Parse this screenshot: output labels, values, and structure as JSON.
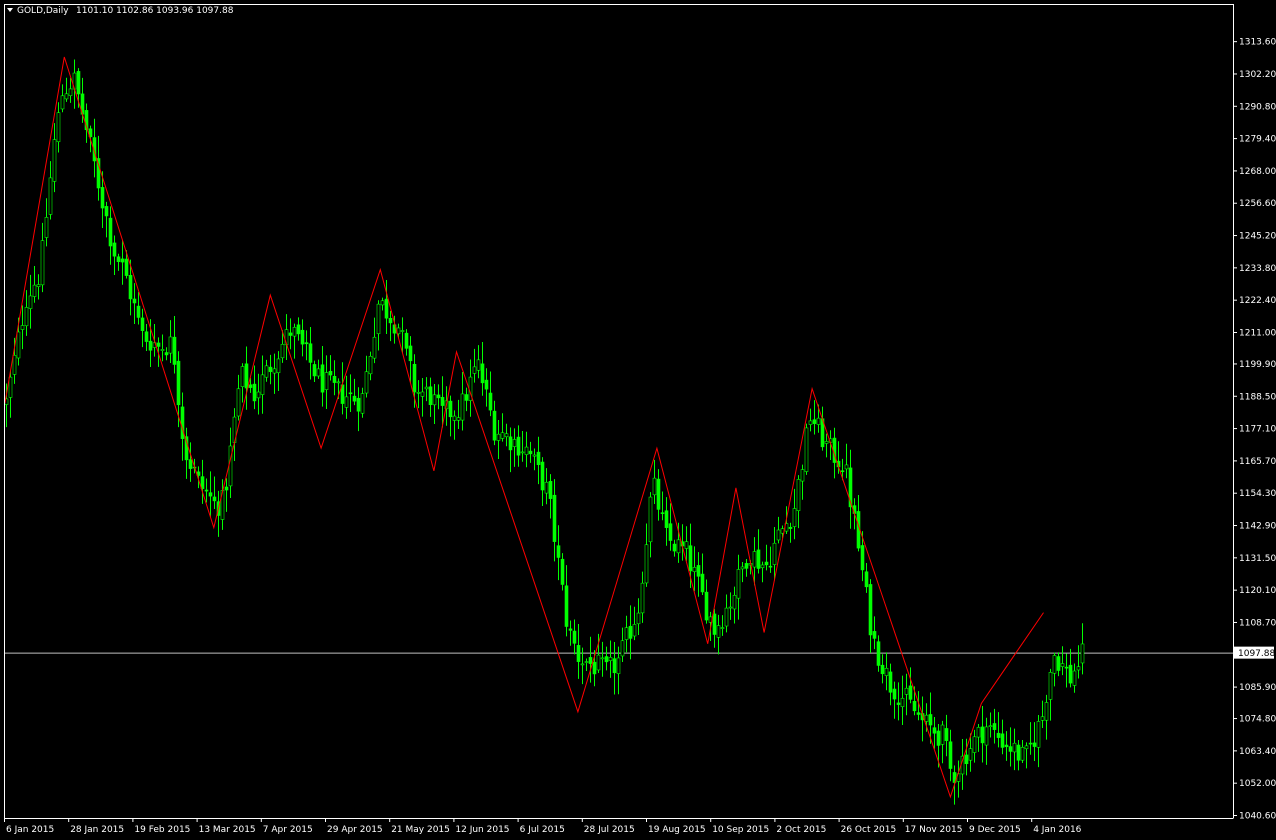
{
  "header": {
    "symbol": "GOLD,Daily",
    "ohlc": "1101.10 1102.86 1093.96 1097.88"
  },
  "colors": {
    "background": "#000000",
    "candle": "#00ff00",
    "zigzag": "#ff0000",
    "axis": "#ffffff",
    "price_line": "#c0c0c0"
  },
  "chart_data": {
    "type": "line",
    "title": "GOLD,Daily",
    "ylim": [
      1040.6,
      1319.3
    ],
    "y_ticks": [
      "1313.60",
      "1302.20",
      "1290.80",
      "1279.40",
      "1268.00",
      "1256.60",
      "1245.20",
      "1233.80",
      "1222.40",
      "1211.00",
      "1199.90",
      "1188.50",
      "1177.10",
      "1165.70",
      "1154.30",
      "1142.90",
      "1131.50",
      "1120.10",
      "1108.70",
      "1097.88",
      "1085.90",
      "1074.80",
      "1063.40",
      "1052.00",
      "1040.60"
    ],
    "x_ticks": [
      "6 Jan 2015",
      "28 Jan 2015",
      "19 Feb 2015",
      "13 Mar 2015",
      "7 Apr 2015",
      "29 Apr 2015",
      "21 May 2015",
      "12 Jun 2015",
      "6 Jul 2015",
      "28 Jul 2015",
      "19 Aug 2015",
      "10 Sep 2015",
      "2 Oct 2015",
      "26 Oct 2015",
      "17 Nov 2015",
      "9 Dec 2015",
      "4 Jan 2016"
    ],
    "current_price": 1097.88,
    "series": [
      {
        "type": "candlestick-close-path",
        "x": [
          "2015-01-02",
          "2015-01-06",
          "2015-01-09",
          "2015-01-14",
          "2015-01-19",
          "2015-01-22",
          "2015-01-26",
          "2015-01-30",
          "2015-02-04",
          "2015-02-09",
          "2015-02-13",
          "2015-02-19",
          "2015-02-25",
          "2015-03-02",
          "2015-03-06",
          "2015-03-11",
          "2015-03-17",
          "2015-03-20",
          "2015-03-26",
          "2015-03-31",
          "2015-04-07",
          "2015-04-13",
          "2015-04-17",
          "2015-04-23",
          "2015-04-29",
          "2015-05-04",
          "2015-05-08",
          "2015-05-14",
          "2015-05-21",
          "2015-05-27",
          "2015-06-01",
          "2015-06-05",
          "2015-06-12",
          "2015-06-18",
          "2015-06-24",
          "2015-06-30",
          "2015-07-06",
          "2015-07-13",
          "2015-07-20",
          "2015-07-24",
          "2015-07-28",
          "2015-08-03",
          "2015-08-07",
          "2015-08-14",
          "2015-08-19",
          "2015-08-24",
          "2015-08-31",
          "2015-09-04",
          "2015-09-10",
          "2015-09-16",
          "2015-09-22",
          "2015-09-28",
          "2015-10-02",
          "2015-10-08",
          "2015-10-14",
          "2015-10-20",
          "2015-10-26",
          "2015-10-30",
          "2015-11-05",
          "2015-11-11",
          "2015-11-17",
          "2015-11-23",
          "2015-11-30",
          "2015-12-03",
          "2015-12-09",
          "2015-12-15",
          "2015-12-21",
          "2015-12-29",
          "2016-01-04",
          "2016-01-08",
          "2016-01-14",
          "2016-01-19"
        ],
        "y": [
          1186,
          1207,
          1223,
          1232,
          1278,
          1296,
          1300,
          1284,
          1262,
          1240,
          1232,
          1210,
          1206,
          1207,
          1170,
          1158,
          1150,
          1151,
          1196,
          1189,
          1202,
          1212,
          1205,
          1194,
          1190,
          1188,
          1187,
          1222,
          1213,
          1190,
          1189,
          1182,
          1184,
          1200,
          1177,
          1173,
          1169,
          1154,
          1106,
          1096,
          1094,
          1091,
          1095,
          1114,
          1158,
          1138,
          1133,
          1122,
          1106,
          1117,
          1134,
          1128,
          1138,
          1148,
          1182,
          1170,
          1164,
          1141,
          1103,
          1087,
          1081,
          1073,
          1068,
          1054,
          1064,
          1072,
          1067,
          1060,
          1075,
          1098,
          1089,
          1098
        ]
      },
      {
        "name": "",
        "type": "zigzag",
        "x": [
          "2015-01-02",
          "2015-01-23",
          "2015-03-17",
          "2015-04-06",
          "2015-04-24",
          "2015-05-15",
          "2015-06-03",
          "2015-06-11",
          "2015-07-24",
          "2015-08-21",
          "2015-09-08",
          "2015-09-18",
          "2015-09-28",
          "2015-10-15",
          "2015-12-03",
          "2015-12-14",
          "2016-01-05"
        ],
        "y": [
          1186,
          1308,
          1142,
          1224,
          1170,
          1233,
          1162,
          1204,
          1077,
          1170,
          1101,
          1156,
          1105,
          1191,
          1047,
          1080,
          1112
        ]
      }
    ]
  }
}
